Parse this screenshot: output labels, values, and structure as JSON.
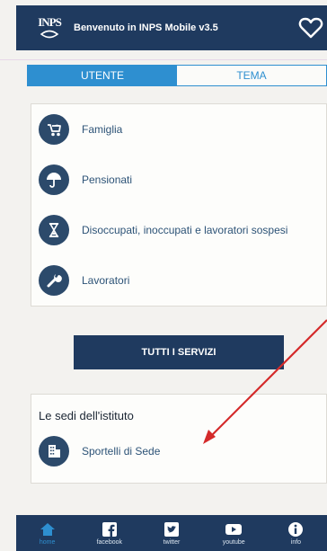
{
  "header": {
    "logo_text": "INPS",
    "title": "Benvenuto in INPS Mobile v3.5"
  },
  "tabs": [
    {
      "label": "UTENTE",
      "active": true
    },
    {
      "label": "TEMA",
      "active": false
    }
  ],
  "menu": {
    "items": [
      {
        "label": "Famiglia",
        "icon": "stroller-icon"
      },
      {
        "label": "Pensionati",
        "icon": "umbrella-icon"
      },
      {
        "label": "Disoccupati, inoccupati e lavoratori sospesi",
        "icon": "hourglass-icon"
      },
      {
        "label": "Lavoratori",
        "icon": "wrench-icon"
      }
    ]
  },
  "all_services_label": "TUTTI I SERVIZI",
  "sedi": {
    "title": "Le sedi dell'istituto",
    "item_label": "Sportelli di Sede",
    "item_icon": "building-icon"
  },
  "bottom_nav": [
    {
      "label": "home",
      "icon": "home-icon"
    },
    {
      "label": "facebook",
      "icon": "facebook-icon"
    },
    {
      "label": "twitter",
      "icon": "twitter-icon"
    },
    {
      "label": "youtube",
      "icon": "youtube-icon"
    },
    {
      "label": "info",
      "icon": "info-icon"
    }
  ],
  "colors": {
    "navy": "#1f3a5f",
    "accent_blue": "#2e8fd0",
    "annotation_red": "#d42a2a"
  }
}
